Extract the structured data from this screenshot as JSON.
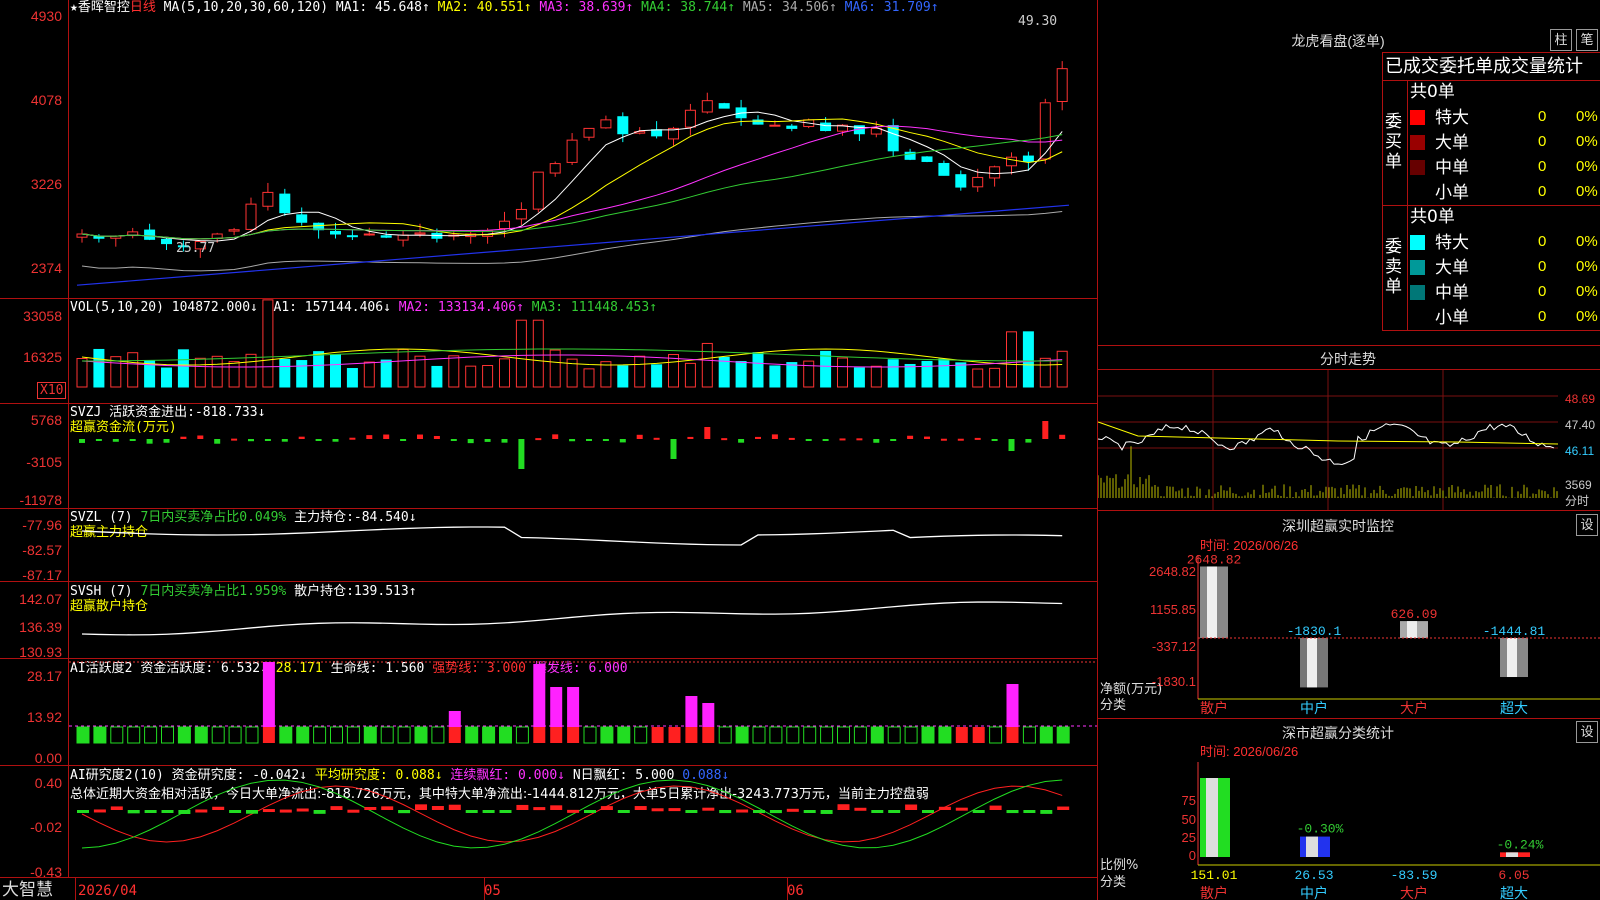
{
  "main": {
    "title": "★香晖智控",
    "period": "日线",
    "ma_label": "MA(5,10,20,30,60,120)",
    "ma": [
      {
        "label": "MA1:",
        "value": "45.648↑",
        "color": "#ffffff"
      },
      {
        "label": "MA2:",
        "value": "40.551↑",
        "color": "#ffff00"
      },
      {
        "label": "MA3:",
        "value": "38.639↑",
        "color": "#ff33ff"
      },
      {
        "label": "MA4:",
        "value": "38.744↑",
        "color": "#33cc33"
      },
      {
        "label": "MA5:",
        "value": "34.506↑",
        "color": "#aaaaaa"
      },
      {
        "label": "MA6:",
        "value": "31.709↑",
        "color": "#3366ff"
      }
    ],
    "y_ticks": [
      "4930",
      "4078",
      "3226",
      "2374"
    ],
    "high_label": "49.30",
    "low_label": "25.77"
  },
  "vol": {
    "label": "VOL(5,10,20)",
    "value": "104872.000↓",
    "ma": [
      {
        "label": "MA1:",
        "value": "157144.406↓",
        "color": "#ffffff"
      },
      {
        "label": "MA2:",
        "value": "133134.406↑",
        "color": "#ff33ff"
      },
      {
        "label": "MA3:",
        "value": "111448.453↑",
        "color": "#33cc33"
      }
    ],
    "y_ticks": [
      "33058",
      "16325"
    ],
    "unit": "X10"
  },
  "svzj": {
    "label": "SVZJ",
    "desc": "活跃资金进出:",
    "value": "-818.733↓",
    "sub": "超赢资金流(万元)",
    "y_ticks": [
      "5768",
      "-3105",
      "-11978"
    ]
  },
  "svzl": {
    "label": "SVZL (7)",
    "desc": "7日内买卖净占比0.049%",
    "desc2": "主力持仓:",
    "value": "-84.540↓",
    "sub": "超赢主力持仓",
    "y_ticks": [
      "-77.96",
      "-82.57",
      "-87.17"
    ]
  },
  "svsh": {
    "label": "SVSH (7)",
    "desc": "7日内买卖净占比1.959%",
    "desc2": "散户持仓:",
    "value": "139.513↑",
    "sub": "超赢散户持仓",
    "y_ticks": [
      "142.07",
      "136.39",
      "130.93"
    ]
  },
  "ai1": {
    "label": "AI活跃度2",
    "items": [
      {
        "text": "资金活跃度:",
        "color": "#ffffff"
      },
      {
        "text": "6.532↓",
        "color": "#ffffff"
      },
      {
        "text": "28.171",
        "color": "#ffff00"
      },
      {
        "text": "生命线:",
        "color": "#ffffff"
      },
      {
        "text": "1.560",
        "color": "#ffffff"
      },
      {
        "text": "强势线:",
        "color": "#ff3030"
      },
      {
        "text": "3.000",
        "color": "#ff3030"
      },
      {
        "text": "爆发线:",
        "color": "#ff33ff"
      },
      {
        "text": "6.000",
        "color": "#ff33ff"
      }
    ],
    "y_ticks": [
      "28.17",
      "13.92",
      "0.00"
    ]
  },
  "ai2": {
    "label": "AI研究度2(10)",
    "items": [
      {
        "text": "资金研究度: -0.042↓",
        "color": "#ffffff"
      },
      {
        "text": "平均研究度: 0.088↓",
        "color": "#ffff00"
      },
      {
        "text": "连续飘红: 0.000↓",
        "color": "#ff33ff"
      },
      {
        "text": "N日飘红: 5.000",
        "color": "#ffffff"
      },
      {
        "text": "0.088↓",
        "color": "#3366ff"
      }
    ],
    "summary": "总体近期大资金相对活跃，今日大单净流出:-818.726万元，其中特大单净流出:-1444.812万元，大单5日累计净出-3243.773万元，当前主力控盘弱",
    "y_ticks": [
      "0.40",
      "-0.02",
      "-0.43"
    ]
  },
  "bottom": {
    "brand": "大智慧",
    "date": "2026/04",
    "months": [
      "05",
      "06"
    ]
  },
  "right": {
    "dragon_title": "龙虎看盘(逐单)",
    "btn1": "柱",
    "btn2": "笔",
    "table_header": "已成交委托单成交量统计",
    "buy_label": "委买单",
    "sell_label": "委卖单",
    "buy_total": "共0单",
    "sell_total": "共0单",
    "buy_rows": [
      {
        "name": "特大",
        "count": "0",
        "pct": "0%",
        "color": "#ff0000"
      },
      {
        "name": "大单",
        "count": "0",
        "pct": "0%",
        "color": "#990000"
      },
      {
        "name": "中单",
        "count": "0",
        "pct": "0%",
        "color": "#660000"
      },
      {
        "name": "小单",
        "count": "0",
        "pct": "0%",
        "color": ""
      }
    ],
    "sell_rows": [
      {
        "name": "特大",
        "count": "0",
        "pct": "0%",
        "color": "#00ffff"
      },
      {
        "name": "大单",
        "count": "0",
        "pct": "0%",
        "color": "#009999"
      },
      {
        "name": "中单",
        "count": "0",
        "pct": "0%",
        "color": "#007777"
      },
      {
        "name": "小单",
        "count": "0",
        "pct": "0%",
        "color": ""
      }
    ],
    "fenshi_title": "分时走势",
    "fenshi_ticks": [
      "48.69",
      "47.40",
      "46.11"
    ],
    "fenshi_vol": "3569",
    "fenshi_unit": "分时",
    "monitor_title": "深圳超赢实时监控",
    "monitor_btn": "设",
    "monitor_time": "时间: 2026/06/26",
    "monitor_ticks": [
      "2648.82",
      "1155.85",
      "-337.12",
      "-1830.1"
    ],
    "monitor_axis_label": "净额(万元)",
    "monitor_axis_sub": "分类",
    "monitor_data": {
      "categories": [
        "散户",
        "中户",
        "大户",
        "超大"
      ],
      "values": [
        2648.82,
        -1830.1,
        626.09,
        -1444.81
      ],
      "labels": [
        "2648.82",
        "-1830.1",
        "626.09",
        "-1444.81"
      ]
    },
    "classify_title": "深市超赢分类统计",
    "classify_btn": "设",
    "classify_time": "时间: 2026/06/26",
    "classify_ticks": [
      "75",
      "50",
      "25",
      "0"
    ],
    "classify_axis_label": "比例%",
    "classify_axis_sub": "分类",
    "classify_data": {
      "categories": [
        "散户",
        "中户",
        "大户",
        "超大"
      ],
      "values": [
        151.01,
        26.53,
        -83.59,
        6.05
      ],
      "labels": [
        "151.01",
        "26.53",
        "-83.59",
        "6.05"
      ],
      "pct_labels": [
        "",
        "-0.30%",
        "",
        "-0.24%"
      ]
    }
  }
}
